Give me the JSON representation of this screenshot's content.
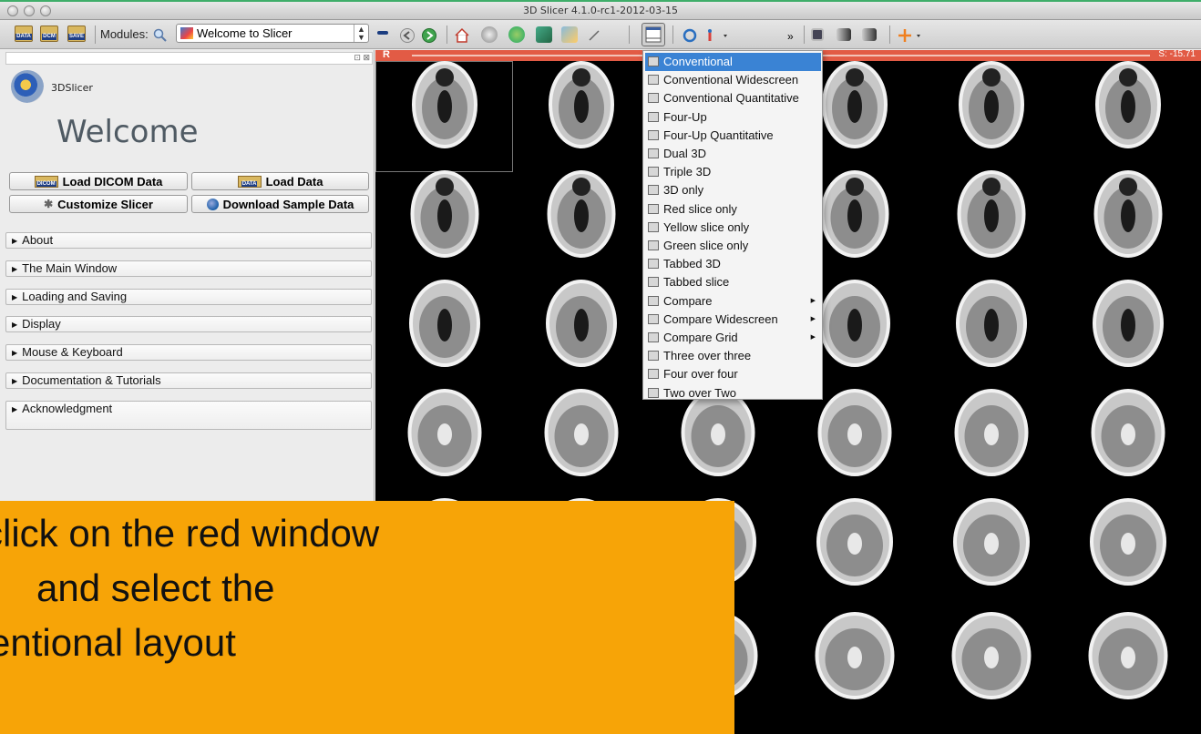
{
  "window": {
    "title": "3D Slicer 4.1.0-rc1-2012-03-15"
  },
  "toolbar": {
    "icon_data": "DATA",
    "icon_dcm": "DCM",
    "icon_save": "SAVE",
    "modules_label": "Modules:",
    "module_selected": "Welcome to Slicer"
  },
  "logo": {
    "text": "3DSlicer"
  },
  "welcome": {
    "heading": "Welcome",
    "buttons": {
      "load_dicom": "Load DICOM Data",
      "load_data": "Load Data",
      "customize": "Customize Slicer",
      "download_sample": "Download Sample Data",
      "dicom_icon": "DICOM",
      "data_icon": "DATA"
    },
    "sections": [
      "About",
      "The Main Window",
      "Loading and Saving",
      "Display",
      "Mouse & Keyboard",
      "Documentation & Tutorials",
      "Acknowledgment"
    ]
  },
  "slice_view": {
    "orientation": "R",
    "offset": "S: -15.71"
  },
  "layout_menu": {
    "items": [
      {
        "label": "Conventional",
        "selected": true,
        "submenu": false
      },
      {
        "label": "Conventional Widescreen",
        "selected": false,
        "submenu": false
      },
      {
        "label": "Conventional Quantitative",
        "selected": false,
        "submenu": false
      },
      {
        "label": "Four-Up",
        "selected": false,
        "submenu": false
      },
      {
        "label": "Four-Up Quantitative",
        "selected": false,
        "submenu": false
      },
      {
        "label": "Dual 3D",
        "selected": false,
        "submenu": false
      },
      {
        "label": "Triple 3D",
        "selected": false,
        "submenu": false
      },
      {
        "label": "3D only",
        "selected": false,
        "submenu": false
      },
      {
        "label": "Red slice only",
        "selected": false,
        "submenu": false
      },
      {
        "label": "Yellow slice only",
        "selected": false,
        "submenu": false
      },
      {
        "label": "Green slice only",
        "selected": false,
        "submenu": false
      },
      {
        "label": "Tabbed 3D",
        "selected": false,
        "submenu": false
      },
      {
        "label": "Tabbed slice",
        "selected": false,
        "submenu": false
      },
      {
        "label": "Compare",
        "selected": false,
        "submenu": true
      },
      {
        "label": "Compare Widescreen",
        "selected": false,
        "submenu": true
      },
      {
        "label": "Compare Grid",
        "selected": false,
        "submenu": true
      },
      {
        "label": "Three over three",
        "selected": false,
        "submenu": false
      },
      {
        "label": "Four over four",
        "selected": false,
        "submenu": false
      },
      {
        "label": "Two over Two",
        "selected": false,
        "submenu": false
      }
    ]
  },
  "callout": {
    "lines": [
      "click on the red window",
      "and select the",
      "entional layout"
    ]
  },
  "colors": {
    "accent": "#3a83d4",
    "red_slice": "#e25b45",
    "callout": "#f7a407"
  }
}
